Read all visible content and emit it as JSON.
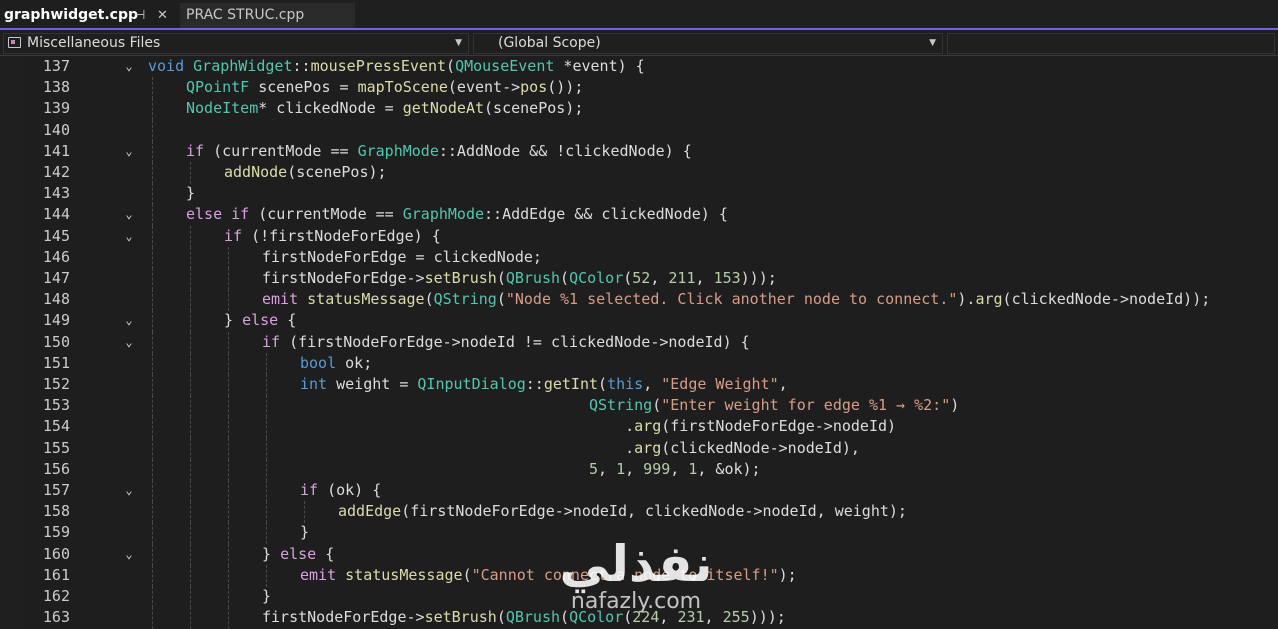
{
  "tabs": [
    {
      "label": "graphwidget.cpp",
      "active": true,
      "pin_icon": "pin-icon",
      "close_icon": "close-icon"
    },
    {
      "label": "PRAC STRUC.cpp",
      "active": false
    }
  ],
  "navbar": {
    "project": "Miscellaneous Files",
    "scope": "(Global Scope)",
    "member": ""
  },
  "colors": {
    "accent": "#7160e8",
    "keyword": "#569cd6",
    "control": "#d8a0df",
    "type": "#4ec9b0",
    "function": "#dcdcaa",
    "string": "#d69d85",
    "number": "#b5cea8",
    "text": "#dcdcdc"
  },
  "code_lines": [
    {
      "n": "137",
      "fold": true,
      "guides": 0,
      "indent": 0,
      "tokens": [
        [
          "kw",
          "void"
        ],
        [
          "tx",
          " "
        ],
        [
          "ty",
          "GraphWidget"
        ],
        [
          "tx",
          "::"
        ],
        [
          "fn",
          "mousePressEvent"
        ],
        [
          "tx",
          "("
        ],
        [
          "ty",
          "QMouseEvent"
        ],
        [
          "tx",
          " *event) {"
        ]
      ]
    },
    {
      "n": "138",
      "fold": false,
      "guides": 1,
      "indent": 1,
      "tokens": [
        [
          "ty",
          "QPointF"
        ],
        [
          "tx",
          " scenePos = "
        ],
        [
          "fn",
          "mapToScene"
        ],
        [
          "tx",
          "(event->"
        ],
        [
          "fn",
          "pos"
        ],
        [
          "tx",
          "());"
        ]
      ]
    },
    {
      "n": "139",
      "fold": false,
      "guides": 1,
      "indent": 1,
      "tokens": [
        [
          "ty",
          "NodeItem"
        ],
        [
          "tx",
          "* clickedNode = "
        ],
        [
          "fn",
          "getNodeAt"
        ],
        [
          "tx",
          "(scenePos);"
        ]
      ]
    },
    {
      "n": "140",
      "fold": false,
      "guides": 1,
      "indent": 1,
      "tokens": []
    },
    {
      "n": "141",
      "fold": true,
      "guides": 1,
      "indent": 1,
      "tokens": [
        [
          "ctl",
          "if"
        ],
        [
          "tx",
          " (currentMode == "
        ],
        [
          "ty",
          "GraphMode"
        ],
        [
          "tx",
          "::AddNode && !clickedNode) {"
        ]
      ]
    },
    {
      "n": "142",
      "fold": false,
      "guides": 2,
      "indent": 2,
      "tokens": [
        [
          "fn",
          "addNode"
        ],
        [
          "tx",
          "(scenePos);"
        ]
      ]
    },
    {
      "n": "143",
      "fold": false,
      "guides": 1,
      "indent": 1,
      "tokens": [
        [
          "tx",
          "}"
        ]
      ]
    },
    {
      "n": "144",
      "fold": true,
      "guides": 1,
      "indent": 1,
      "tokens": [
        [
          "ctl",
          "else"
        ],
        [
          "tx",
          " "
        ],
        [
          "ctl",
          "if"
        ],
        [
          "tx",
          " (currentMode == "
        ],
        [
          "ty",
          "GraphMode"
        ],
        [
          "tx",
          "::AddEdge && clickedNode) {"
        ]
      ]
    },
    {
      "n": "145",
      "fold": true,
      "guides": 2,
      "indent": 2,
      "tokens": [
        [
          "ctl",
          "if"
        ],
        [
          "tx",
          " (!firstNodeForEdge) {"
        ]
      ]
    },
    {
      "n": "146",
      "fold": false,
      "guides": 3,
      "indent": 3,
      "tokens": [
        [
          "tx",
          "firstNodeForEdge = clickedNode;"
        ]
      ]
    },
    {
      "n": "147",
      "fold": false,
      "guides": 3,
      "indent": 3,
      "tokens": [
        [
          "tx",
          "firstNodeForEdge->"
        ],
        [
          "fn",
          "setBrush"
        ],
        [
          "tx",
          "("
        ],
        [
          "ty",
          "QBrush"
        ],
        [
          "tx",
          "("
        ],
        [
          "ty",
          "QColor"
        ],
        [
          "tx",
          "("
        ],
        [
          "nu",
          "52"
        ],
        [
          "tx",
          ", "
        ],
        [
          "nu",
          "211"
        ],
        [
          "tx",
          ", "
        ],
        [
          "nu",
          "153"
        ],
        [
          "tx",
          ")));"
        ]
      ]
    },
    {
      "n": "148",
      "fold": false,
      "guides": 3,
      "indent": 3,
      "tokens": [
        [
          "ctl",
          "emit"
        ],
        [
          "tx",
          " "
        ],
        [
          "fn",
          "statusMessage"
        ],
        [
          "tx",
          "("
        ],
        [
          "ty",
          "QString"
        ],
        [
          "tx",
          "("
        ],
        [
          "st",
          "\"Node %1 selected. Click another node to connect.\""
        ],
        [
          "tx",
          ")."
        ],
        [
          "fn",
          "arg"
        ],
        [
          "tx",
          "(clickedNode->nodeId));"
        ]
      ]
    },
    {
      "n": "149",
      "fold": true,
      "guides": 2,
      "indent": 2,
      "tokens": [
        [
          "tx",
          "} "
        ],
        [
          "ctl",
          "else"
        ],
        [
          "tx",
          " {"
        ]
      ]
    },
    {
      "n": "150",
      "fold": true,
      "guides": 3,
      "indent": 3,
      "tokens": [
        [
          "ctl",
          "if"
        ],
        [
          "tx",
          " (firstNodeForEdge->nodeId != clickedNode->nodeId) {"
        ]
      ]
    },
    {
      "n": "151",
      "fold": false,
      "guides": 4,
      "indent": 4,
      "tokens": [
        [
          "kw",
          "bool"
        ],
        [
          "tx",
          " ok;"
        ]
      ]
    },
    {
      "n": "152",
      "fold": false,
      "guides": 4,
      "indent": 4,
      "tokens": [
        [
          "kw",
          "int"
        ],
        [
          "tx",
          " weight = "
        ],
        [
          "ty",
          "QInputDialog"
        ],
        [
          "tx",
          "::"
        ],
        [
          "fn",
          "getInt"
        ],
        [
          "tx",
          "("
        ],
        [
          "kw",
          "this"
        ],
        [
          "tx",
          ", "
        ],
        [
          "st",
          "\"Edge Weight\""
        ],
        [
          "tx",
          ","
        ]
      ]
    },
    {
      "n": "153",
      "fold": false,
      "guides": 4,
      "indent": 4,
      "tokens": [
        [
          "tx",
          "                                "
        ],
        [
          "ty",
          "QString"
        ],
        [
          "tx",
          "("
        ],
        [
          "st",
          "\"Enter weight for edge %1 → %2:\""
        ],
        [
          "tx",
          ")"
        ]
      ]
    },
    {
      "n": "154",
      "fold": false,
      "guides": 4,
      "indent": 4,
      "tokens": [
        [
          "tx",
          "                                    ."
        ],
        [
          "fn",
          "arg"
        ],
        [
          "tx",
          "(firstNodeForEdge->nodeId)"
        ]
      ]
    },
    {
      "n": "155",
      "fold": false,
      "guides": 4,
      "indent": 4,
      "tokens": [
        [
          "tx",
          "                                    ."
        ],
        [
          "fn",
          "arg"
        ],
        [
          "tx",
          "(clickedNode->nodeId),"
        ]
      ]
    },
    {
      "n": "156",
      "fold": false,
      "guides": 4,
      "indent": 4,
      "tokens": [
        [
          "tx",
          "                                "
        ],
        [
          "nu",
          "5"
        ],
        [
          "tx",
          ", "
        ],
        [
          "nu",
          "1"
        ],
        [
          "tx",
          ", "
        ],
        [
          "nu",
          "999"
        ],
        [
          "tx",
          ", "
        ],
        [
          "nu",
          "1"
        ],
        [
          "tx",
          ", &ok);"
        ]
      ]
    },
    {
      "n": "157",
      "fold": true,
      "guides": 4,
      "indent": 4,
      "tokens": [
        [
          "ctl",
          "if"
        ],
        [
          "tx",
          " (ok) {"
        ]
      ]
    },
    {
      "n": "158",
      "fold": false,
      "guides": 5,
      "indent": 5,
      "tokens": [
        [
          "fn",
          "addEdge"
        ],
        [
          "tx",
          "(firstNodeForEdge->nodeId, clickedNode->nodeId, weight);"
        ]
      ]
    },
    {
      "n": "159",
      "fold": false,
      "guides": 4,
      "indent": 4,
      "tokens": [
        [
          "tx",
          "}"
        ]
      ]
    },
    {
      "n": "160",
      "fold": true,
      "guides": 3,
      "indent": 3,
      "tokens": [
        [
          "tx",
          "} "
        ],
        [
          "ctl",
          "else"
        ],
        [
          "tx",
          " {"
        ]
      ]
    },
    {
      "n": "161",
      "fold": false,
      "guides": 4,
      "indent": 4,
      "tokens": [
        [
          "ctl",
          "emit"
        ],
        [
          "tx",
          " "
        ],
        [
          "fn",
          "statusMessage"
        ],
        [
          "tx",
          "("
        ],
        [
          "st",
          "\"Cannot connect a node to itself!\""
        ],
        [
          "tx",
          ");"
        ]
      ]
    },
    {
      "n": "162",
      "fold": false,
      "guides": 3,
      "indent": 3,
      "tokens": [
        [
          "tx",
          "}"
        ]
      ]
    },
    {
      "n": "163",
      "fold": false,
      "guides": 3,
      "indent": 3,
      "tokens": [
        [
          "tx",
          "firstNodeForEdge->"
        ],
        [
          "fn",
          "setBrush"
        ],
        [
          "tx",
          "("
        ],
        [
          "ty",
          "QBrush"
        ],
        [
          "tx",
          "("
        ],
        [
          "ty",
          "QColor"
        ],
        [
          "tx",
          "("
        ],
        [
          "nu",
          "224"
        ],
        [
          "tx",
          ", "
        ],
        [
          "nu",
          "231"
        ],
        [
          "tx",
          ", "
        ],
        [
          "nu",
          "255"
        ],
        [
          "tx",
          ")));"
        ]
      ]
    }
  ],
  "watermark": {
    "text": "نفذلي",
    "url": "nafazly.com"
  }
}
